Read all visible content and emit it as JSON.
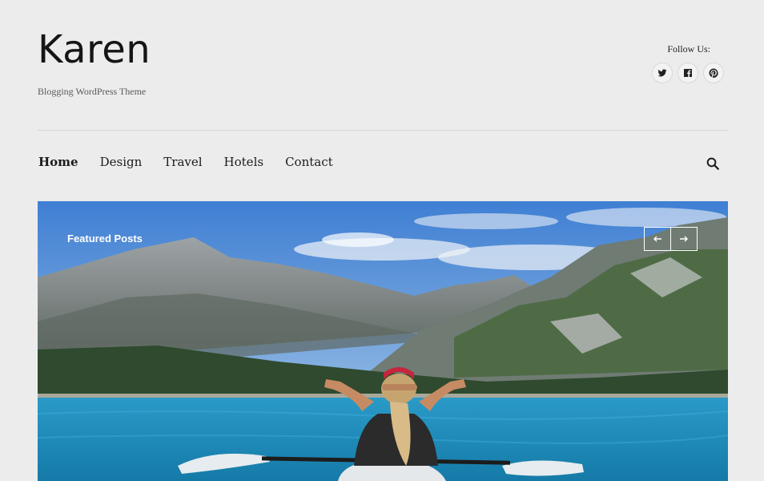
{
  "site": {
    "title": "Karen",
    "tagline": "Blogging WordPress Theme"
  },
  "social": {
    "label": "Follow Us:",
    "icons": [
      "twitter-icon",
      "facebook-icon",
      "pinterest-icon"
    ]
  },
  "nav": {
    "items": [
      {
        "label": "Home",
        "active": true
      },
      {
        "label": "Design",
        "active": false
      },
      {
        "label": "Travel",
        "active": false
      },
      {
        "label": "Hotels",
        "active": false
      },
      {
        "label": "Contact",
        "active": false
      }
    ],
    "search_icon": "search-icon"
  },
  "hero": {
    "label": "Featured Posts",
    "prev_icon": "arrow-left-icon",
    "next_icon": "arrow-right-icon"
  },
  "colors": {
    "background": "#ececec",
    "text": "#1a1a1a",
    "sky": "#4a86d6",
    "water": "#1f86b8"
  }
}
